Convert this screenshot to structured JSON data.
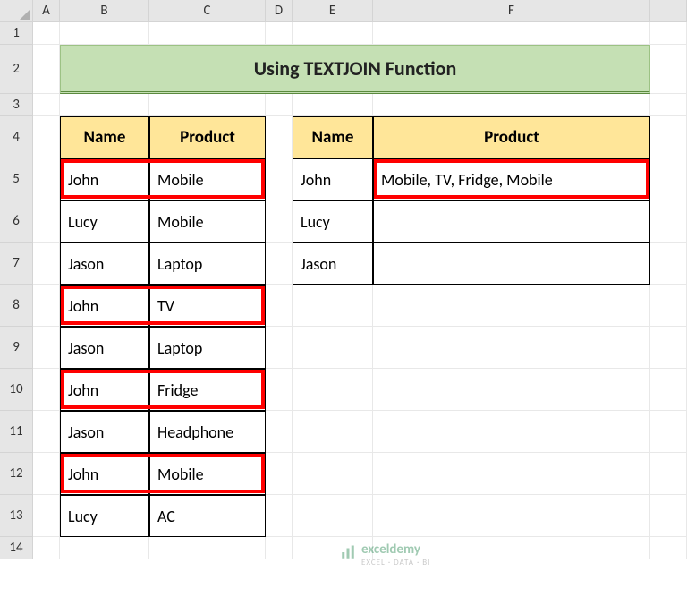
{
  "columns": [
    "A",
    "B",
    "C",
    "D",
    "E",
    "F"
  ],
  "rows": [
    "1",
    "2",
    "3",
    "4",
    "5",
    "6",
    "7",
    "8",
    "9",
    "10",
    "11",
    "12",
    "13",
    "14"
  ],
  "title": "Using TEXTJOIN Function",
  "table1": {
    "headers": {
      "name": "Name",
      "product": "Product"
    },
    "rows": [
      {
        "name": "John",
        "product": "Mobile"
      },
      {
        "name": "Lucy",
        "product": "Mobile"
      },
      {
        "name": "Jason",
        "product": "Laptop"
      },
      {
        "name": "John",
        "product": "TV"
      },
      {
        "name": "Jason",
        "product": "Laptop"
      },
      {
        "name": "John",
        "product": "Fridge"
      },
      {
        "name": "Jason",
        "product": "Headphone"
      },
      {
        "name": "John",
        "product": "Mobile"
      },
      {
        "name": "Lucy",
        "product": "AC"
      }
    ]
  },
  "table2": {
    "headers": {
      "name": "Name",
      "product": "Product"
    },
    "rows": [
      {
        "name": "John",
        "product": "Mobile, TV, Fridge, Mobile"
      },
      {
        "name": "Lucy",
        "product": ""
      },
      {
        "name": "Jason",
        "product": ""
      }
    ]
  },
  "watermark": {
    "brand": "exceldemy",
    "sub": "EXCEL · DATA · BI"
  }
}
